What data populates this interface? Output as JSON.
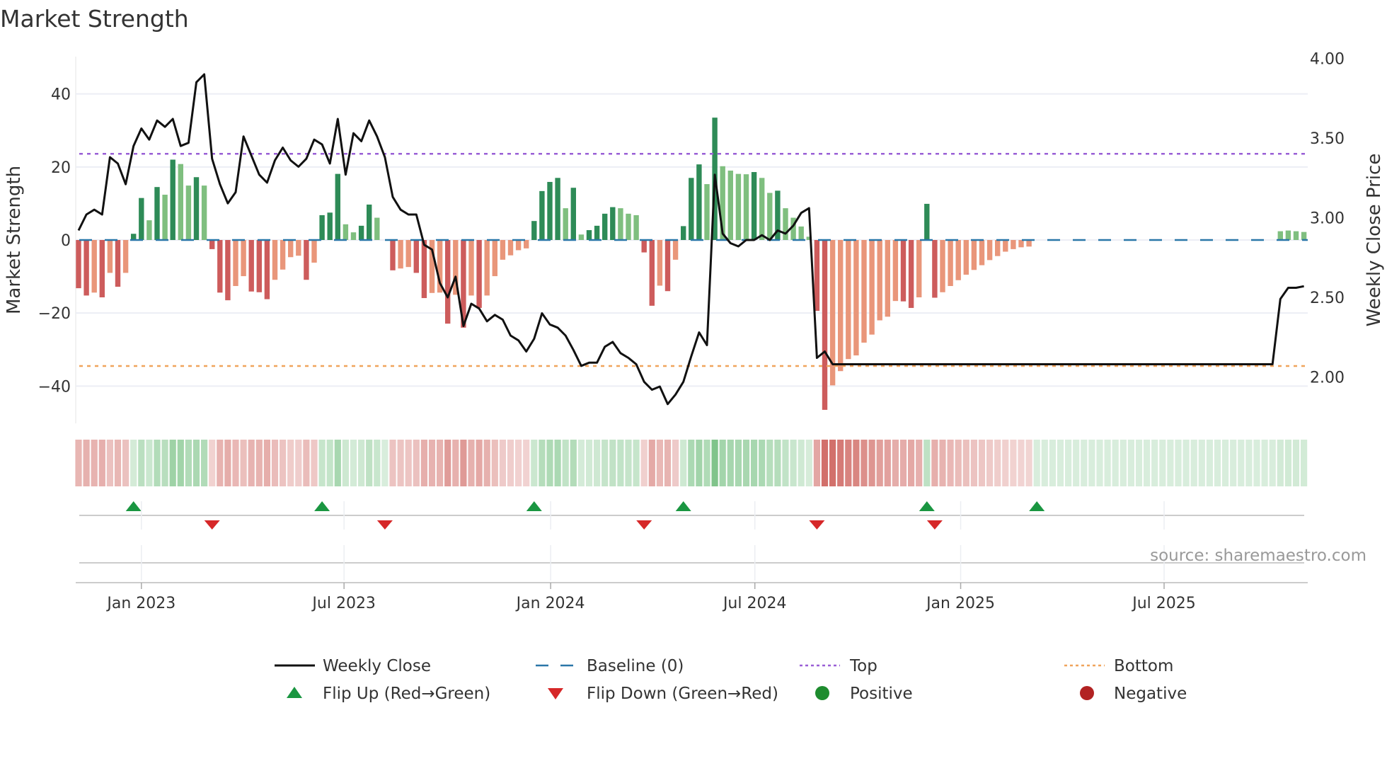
{
  "title": "Market Strength",
  "source": "source: sharemaestro.com",
  "chart_data": {
    "type": "bar",
    "title": "Market Strength",
    "ylabel": "Market Strength",
    "y2label": "Weekly Close Price",
    "ylim": [
      -50.2,
      50.2
    ],
    "y2lim": [
      1.709,
      4.011
    ],
    "yticks": [
      40,
      20,
      0,
      -20,
      -40
    ],
    "ytick_labels": [
      "40",
      "20",
      "0",
      "−20",
      "−40"
    ],
    "y2ticks": [
      4.0,
      3.5,
      3.0,
      2.5,
      2.0
    ],
    "y2tick_labels": [
      "4.00",
      "3.50",
      "3.00",
      "2.50",
      "2.00"
    ],
    "x_unit": "week index",
    "xticks": [
      {
        "week": 8.0,
        "label": "Jan 2023"
      },
      {
        "week": 33.8,
        "label": "Jul 2023"
      },
      {
        "week": 60.1,
        "label": "Jan 2024"
      },
      {
        "week": 86.1,
        "label": "Jul 2024"
      },
      {
        "week": 112.3,
        "label": "Jan 2025"
      },
      {
        "week": 138.2,
        "label": "Jul 2025"
      }
    ],
    "top_level": 23.6,
    "bottom_level": -34.5,
    "baseline": 0,
    "strength": [
      -13.2,
      -15.2,
      -14.4,
      -15.7,
      -9,
      -12.8,
      -9,
      1.7,
      11.5,
      5.4,
      14.5,
      12.4,
      22,
      20.8,
      14.9,
      17.2,
      14.9,
      -2.5,
      -14.4,
      -16.5,
      -12.6,
      -9.9,
      -14.1,
      -14.3,
      -16.2,
      -10.9,
      -8.1,
      -4.7,
      -4.3,
      -10.9,
      -6.2,
      6.8,
      7.5,
      18.1,
      4.3,
      2.1,
      3.9,
      9.7,
      6.1,
      0,
      -8.3,
      -7.8,
      -7.4,
      -9,
      -15.9,
      -14.5,
      -14.4,
      -22.9,
      -15,
      -24,
      -15.2,
      -18.6,
      -15.2,
      -9.9,
      -5.4,
      -4.2,
      -2.8,
      -2.3,
      5.2,
      13.4,
      15.9,
      17,
      8.7,
      14.3,
      1.5,
      2.7,
      3.9,
      7.2,
      9,
      8.7,
      7.2,
      6.8,
      -3.4,
      -18,
      -12.5,
      -14,
      -5.4,
      3.8,
      17,
      20.7,
      15.3,
      33.5,
      20.2,
      19,
      18.1,
      18,
      18.6,
      17,
      12.9,
      13.5,
      8.7,
      6.1,
      3.7,
      0.9,
      -19.4,
      -46.5,
      -39.8,
      -35.9,
      -32.6,
      -31.6,
      -28.1,
      -25.9,
      -22,
      -21,
      -16.7,
      -16.8,
      -18.6,
      -15.7,
      9.9,
      -15.8,
      -14.3,
      -12.6,
      -11,
      -9.5,
      -8.2,
      -6.9,
      -5.5,
      -4.4,
      -3.2,
      -2.5,
      -2,
      -1.8,
      0,
      0,
      0,
      0,
      0,
      0,
      0,
      0,
      0,
      0,
      0,
      0,
      0,
      0,
      0,
      0,
      0,
      0,
      0,
      0,
      0,
      0,
      0,
      0,
      0,
      0,
      0,
      0,
      0,
      0,
      0,
      2.4,
      2.6,
      2.4,
      2.2
    ],
    "shade": "DDLDLDLDDLDLDLLDLDDDLLDDDLLLLDLDDDLLDDLLDLLDDLLDLDLDLLLLLLDDDDLDLDDDDLLLDDLDLDDDLDLLLLDLLDLLLLDDLLLLLLLLLDDLDDLLLLLLLLLLLLLLLLLLLLLLLLLLLLLLLLLLLLLLLLLLLLLLLLLLLDDLL",
    "weekly_close": [
      2.92,
      3.02,
      3.05,
      3.02,
      3.38,
      3.34,
      3.21,
      3.45,
      3.56,
      3.49,
      3.61,
      3.57,
      3.62,
      3.45,
      3.47,
      3.85,
      3.9,
      3.37,
      3.21,
      3.09,
      3.16,
      3.51,
      3.39,
      3.27,
      3.22,
      3.36,
      3.44,
      3.36,
      3.32,
      3.37,
      3.49,
      3.46,
      3.34,
      3.62,
      3.27,
      3.53,
      3.48,
      3.61,
      3.51,
      3.38,
      3.13,
      3.05,
      3.02,
      3.02,
      2.83,
      2.8,
      2.59,
      2.5,
      2.63,
      2.32,
      2.46,
      2.43,
      2.35,
      2.39,
      2.36,
      2.26,
      2.23,
      2.16,
      2.24,
      2.4,
      2.33,
      2.31,
      2.26,
      2.17,
      2.07,
      2.09,
      2.09,
      2.19,
      2.22,
      2.15,
      2.12,
      2.08,
      1.97,
      1.92,
      1.94,
      1.83,
      1.89,
      1.97,
      2.13,
      2.28,
      2.2,
      3.27,
      2.9,
      2.84,
      2.82,
      2.86,
      2.86,
      2.89,
      2.86,
      2.92,
      2.9,
      2.95,
      3.03,
      3.06,
      2.12,
      2.16,
      2.08,
      2.08,
      2.08,
      2.08,
      2.08,
      2.08,
      2.08,
      2.08,
      2.08,
      2.08,
      2.08,
      2.08,
      2.08,
      2.08,
      2.08,
      2.08,
      2.08,
      2.08,
      2.08,
      2.08,
      2.08,
      2.08,
      2.08,
      2.08,
      2.08,
      2.08,
      2.08,
      2.08,
      2.08,
      2.08,
      2.08,
      2.08,
      2.08,
      2.08,
      2.08,
      2.08,
      2.08,
      2.08,
      2.08,
      2.08,
      2.08,
      2.08,
      2.08,
      2.08,
      2.08,
      2.08,
      2.08,
      2.08,
      2.08,
      2.08,
      2.08,
      2.08,
      2.08,
      2.08,
      2.08,
      2.08,
      2.08,
      2.49,
      2.56,
      2.56,
      2.57
    ],
    "flip_up_weeks": [
      7,
      31,
      58,
      77,
      108,
      122
    ],
    "flip_down_weeks": [
      17,
      39,
      72,
      94,
      109
    ],
    "legend": {
      "placement": "bottom",
      "items": [
        {
          "label": "Weekly Close",
          "symbol": "line"
        },
        {
          "label": "Baseline (0)",
          "symbol": "dash"
        },
        {
          "label": "Top",
          "symbol": "dot-purple"
        },
        {
          "label": "Bottom",
          "symbol": "dot-orange"
        },
        {
          "label": "Flip Up (Red→Green)",
          "symbol": "triangle-up"
        },
        {
          "label": "Flip Down (Green→Red)",
          "symbol": "triangle-down"
        },
        {
          "label": "Positive",
          "symbol": "circle-green"
        },
        {
          "label": "Negative",
          "symbol": "circle-red"
        }
      ]
    },
    "colors": {
      "pos_dark": "#2e8b57",
      "pos_light": "#7fbf7f",
      "neg_dark": "#cd5c5c",
      "neg_light": "#e9967a",
      "line": "#111111",
      "baseline": "#2a77a8",
      "top": "#9a5fd6",
      "bottom": "#f0a45c",
      "flip_up": "#1a9641",
      "flip_down": "#d62728",
      "positive": "#1e8c2e",
      "negative": "#b22222"
    }
  }
}
